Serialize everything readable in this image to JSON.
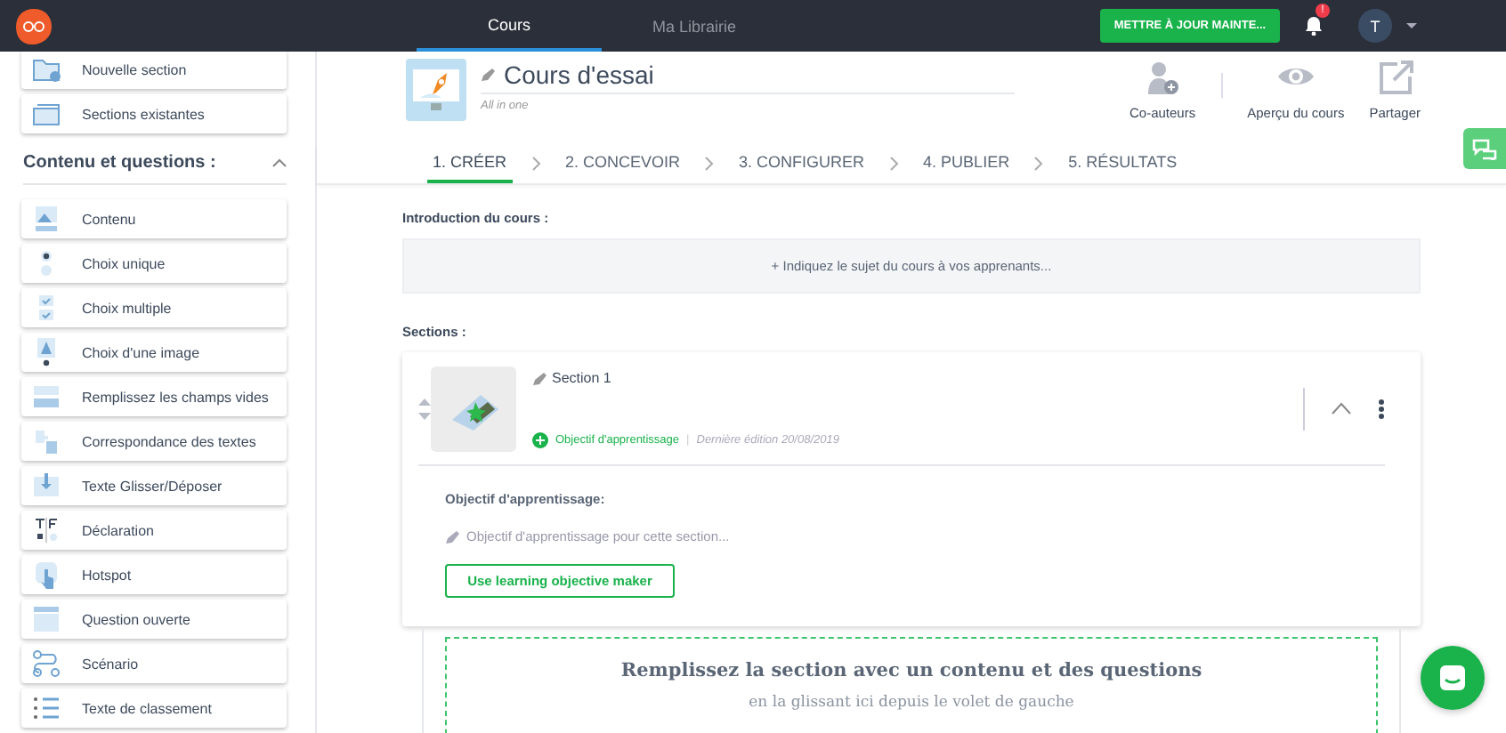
{
  "topbar": {
    "tabs": [
      {
        "label": "Cours",
        "selected": true
      },
      {
        "label": "Ma Librairie",
        "selected": false
      }
    ],
    "update_button": "METTRE À JOUR MAINTE...",
    "notification_badge": "!",
    "avatar": "T"
  },
  "sidebar": {
    "top_items": [
      {
        "label": "Nouvelle section",
        "kind": "new"
      },
      {
        "label": "Sections existantes",
        "kind": "existing"
      }
    ],
    "heading": "Contenu et questions :",
    "expanded": true,
    "items": [
      {
        "label": "Contenu",
        "kind": "content"
      },
      {
        "label": "Choix unique",
        "kind": "single"
      },
      {
        "label": "Choix multiple",
        "kind": "multiple"
      },
      {
        "label": "Choix d'une image",
        "kind": "image"
      },
      {
        "label": "Remplissez les champs vides",
        "kind": "blanks"
      },
      {
        "label": "Correspondance des textes",
        "kind": "matching"
      },
      {
        "label": "Texte Glisser/Déposer",
        "kind": "dragdrop"
      },
      {
        "label": "Déclaration",
        "kind": "statement"
      },
      {
        "label": "Hotspot",
        "kind": "hotspot"
      },
      {
        "label": "Question ouverte",
        "kind": "open"
      },
      {
        "label": "Scénario",
        "kind": "scenario"
      },
      {
        "label": "Texte de classement",
        "kind": "ranking"
      }
    ]
  },
  "course": {
    "title": "Cours d'essai",
    "subtitle": "All in one",
    "actions": [
      {
        "label": "Co-auteurs",
        "kind": "coauthors"
      },
      {
        "label": "Aperçu du cours",
        "kind": "preview"
      },
      {
        "label": "Partager",
        "kind": "share"
      }
    ]
  },
  "steps": [
    {
      "label": "1. CRÉER",
      "selected": true
    },
    {
      "label": "2. CONCEVOIR",
      "selected": false
    },
    {
      "label": "3. CONFIGURER",
      "selected": false
    },
    {
      "label": "4. PUBLIER",
      "selected": false
    },
    {
      "label": "5. RÉSULTATS",
      "selected": false
    }
  ],
  "intro": {
    "label": "Introduction du cours :",
    "placeholder": "+ Indiquez le sujet du cours à vos apprenants..."
  },
  "sections": {
    "label": "Sections :",
    "items": [
      {
        "title": "Section 1",
        "objective_link": "Objectif d'apprentissage",
        "separator": "|",
        "last_edit": "Dernière édition 20/08/2019",
        "expanded": true,
        "objective_label": "Objectif d'apprentissage:",
        "objective_placeholder": "Objectif d'apprentissage pour cette section...",
        "maker_button": "Use learning objective maker"
      }
    ]
  },
  "dropzone": {
    "title": "Remplissez la section avec un contenu et des questions",
    "hint": "en la glissant ici depuis le volet de gauche"
  }
}
